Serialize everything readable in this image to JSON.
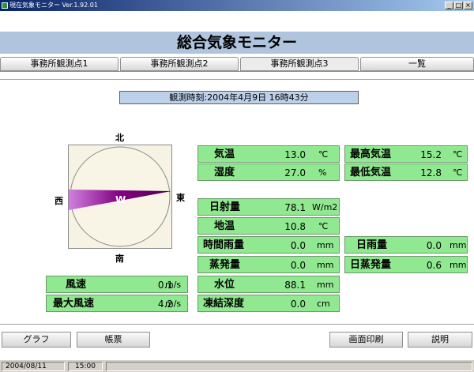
{
  "window": {
    "title": "現在気象モニター Ver.1.92.01"
  },
  "header": {
    "title": "総合気象モニター"
  },
  "tabs": [
    {
      "label": "事務所観測点1"
    },
    {
      "label": "事務所観測点2"
    },
    {
      "label": "事務所観測点3"
    },
    {
      "label": "一覧"
    }
  ],
  "observation_time": "観測時刻:2004年4月9日 16時43分",
  "compass": {
    "north": "北",
    "south": "南",
    "east": "東",
    "west": "西",
    "direction": "W"
  },
  "wind": [
    {
      "label": "風速",
      "value": "0.1",
      "unit": "m/s"
    },
    {
      "label": "最大風速",
      "value": "4.2",
      "unit": "m/s"
    }
  ],
  "weather1": [
    {
      "label": "気温",
      "value": "13.0",
      "unit": "℃"
    },
    {
      "label": "湿度",
      "value": "27.0",
      "unit": "%"
    }
  ],
  "weather2": [
    {
      "label": "日射量",
      "value": "78.1",
      "unit": "W/m2"
    },
    {
      "label": "地温",
      "value": "10.8",
      "unit": "℃"
    },
    {
      "label": "時間雨量",
      "value": "0.0",
      "unit": "mm"
    },
    {
      "label": "蒸発量",
      "value": "0.0",
      "unit": "mm"
    },
    {
      "label": "水位",
      "value": "88.1",
      "unit": "mm"
    },
    {
      "label": "凍結深度",
      "value": "0.0",
      "unit": "cm"
    }
  ],
  "temps": [
    {
      "label": "最高気温",
      "value": "15.2",
      "unit": "℃"
    },
    {
      "label": "最低気温",
      "value": "12.8",
      "unit": "℃"
    }
  ],
  "daily": [
    {
      "label": "日雨量",
      "value": "0.0",
      "unit": "mm"
    },
    {
      "label": "日蒸発量",
      "value": "0.6",
      "unit": "mm"
    }
  ],
  "buttons": {
    "graph": "グラフ",
    "report": "帳票",
    "print": "画面印刷",
    "help": "説明"
  },
  "status": {
    "date": "2004/08/11",
    "time": "15:00"
  },
  "colors": {
    "panel": "#90e890",
    "banner": "#b0c4de",
    "wind_arrow": "#800080"
  }
}
